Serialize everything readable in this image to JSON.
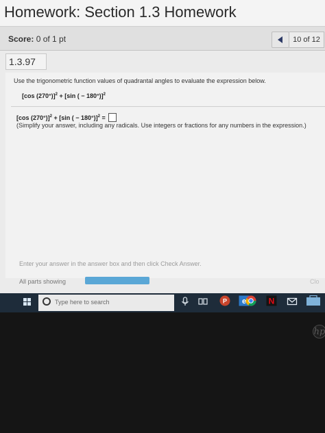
{
  "header": {
    "title": "Homework: Section 1.3 Homework"
  },
  "score": {
    "label": "Score:",
    "value": "0 of 1 pt"
  },
  "nav": {
    "question_count": "10 of 12"
  },
  "question": {
    "id": "1.3.97",
    "instruction": "Use the trigonometric function values of quadrantal angles to evaluate the expression below.",
    "expression": {
      "cos_part": "[cos (270°)]",
      "exp1": "2",
      "plus": " + ",
      "sin_part": "[sin ( − 180°)]",
      "exp2": "2"
    },
    "answer_prompt": {
      "cos_part": "[cos (270°)]",
      "exp1": "2",
      "plus": " + ",
      "sin_part": "[sin ( − 180°)]",
      "exp2": "2",
      "equals": " = "
    },
    "simplify_note": "(Simplify your answer, including any radicals. Use integers or fractions for any numbers in the expression.)"
  },
  "footer": {
    "enter_hint": "Enter your answer in the answer box and then click Check Answer.",
    "all_parts": "All parts showing",
    "progress": 1.0,
    "clear_label": "Clo"
  },
  "taskbar": {
    "search_placeholder": "Type here to search",
    "icons": [
      "windows-start-icon",
      "microphone-icon",
      "task-view-icon",
      "powerpoint-icon",
      "edge-icon",
      "chrome-icon",
      "netflix-icon",
      "mail-icon",
      "store-icon"
    ]
  },
  "colors": {
    "accent": "#5aa7d6",
    "nav_arrow": "#2d3a66",
    "taskbar": "#1e2c3a"
  },
  "brand": {
    "laptop_logo": "hp"
  }
}
